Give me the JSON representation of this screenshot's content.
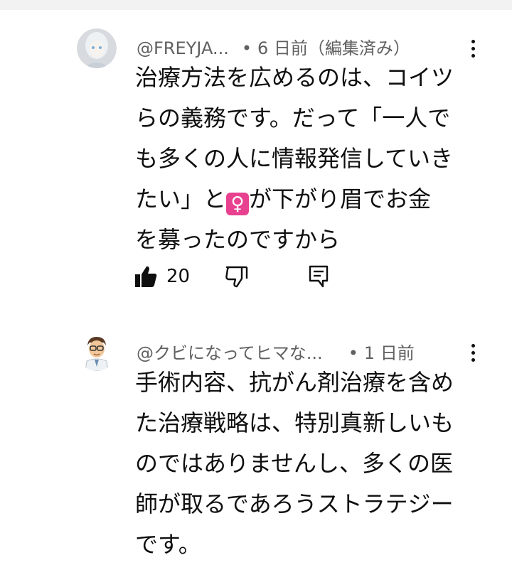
{
  "comments": [
    {
      "author": "@FREYJA...",
      "separator": "•",
      "time": "6 日前（編集済み）",
      "lines": [
        "治療方法を広めるのは、コイツ",
        "らの義務です。だって「一人で",
        "も多くの人に情報発信していき"
      ],
      "line4_before": "たい」と",
      "emoji": "♀",
      "line4_after": "が下がり眉でお金",
      "line5": "を募ったのですから",
      "like_count": "20"
    },
    {
      "author": "@クビになってヒマな...",
      "separator": "•",
      "time": "1 日前",
      "lines": [
        "手術内容、抗がん剤治療を含め",
        "た治療戦略は、特別真新しいも",
        "のではありませんし、多くの医",
        "師が取るであろうストラテジー",
        "です。"
      ]
    }
  ],
  "icons": {
    "like": "thumbs-up-icon",
    "dislike": "thumbs-down-icon",
    "reply": "comment-icon",
    "menu": "more-vert-icon"
  },
  "colors": {
    "text": "#0f0f0f",
    "meta": "#606060",
    "emoji_bg": "#e8418f"
  }
}
